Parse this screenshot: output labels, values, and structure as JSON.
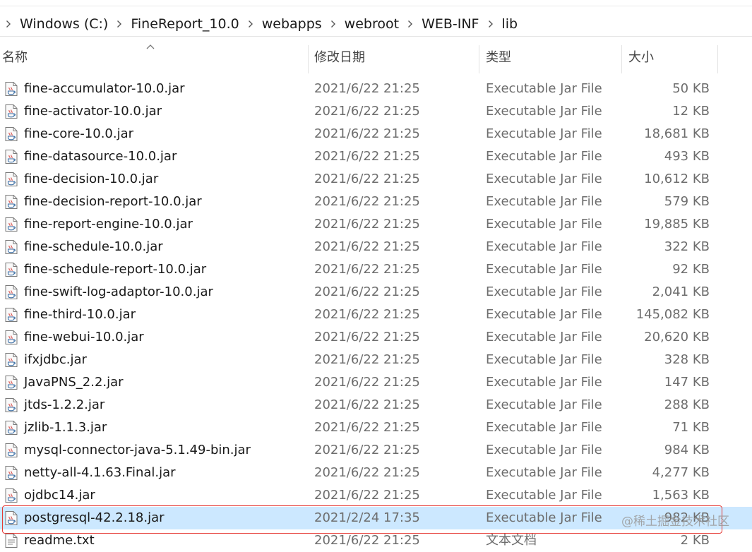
{
  "breadcrumb": [
    "Windows (C:)",
    "FineReport_10.0",
    "webapps",
    "webroot",
    "WEB-INF",
    "lib"
  ],
  "columns": {
    "name": "名称",
    "date": "修改日期",
    "type": "类型",
    "size": "大小"
  },
  "files": [
    {
      "name": "fine-accumulator-10.0.jar",
      "date": "2021/6/22 21:25",
      "type": "Executable Jar File",
      "size": "50 KB",
      "icon": "jar-file-icon"
    },
    {
      "name": "fine-activator-10.0.jar",
      "date": "2021/6/22 21:25",
      "type": "Executable Jar File",
      "size": "12 KB",
      "icon": "jar-file-icon"
    },
    {
      "name": "fine-core-10.0.jar",
      "date": "2021/6/22 21:25",
      "type": "Executable Jar File",
      "size": "18,681 KB",
      "icon": "jar-file-icon"
    },
    {
      "name": "fine-datasource-10.0.jar",
      "date": "2021/6/22 21:25",
      "type": "Executable Jar File",
      "size": "493 KB",
      "icon": "jar-file-icon"
    },
    {
      "name": "fine-decision-10.0.jar",
      "date": "2021/6/22 21:25",
      "type": "Executable Jar File",
      "size": "10,612 KB",
      "icon": "jar-file-icon"
    },
    {
      "name": "fine-decision-report-10.0.jar",
      "date": "2021/6/22 21:25",
      "type": "Executable Jar File",
      "size": "579 KB",
      "icon": "jar-file-icon"
    },
    {
      "name": "fine-report-engine-10.0.jar",
      "date": "2021/6/22 21:25",
      "type": "Executable Jar File",
      "size": "19,885 KB",
      "icon": "jar-file-icon"
    },
    {
      "name": "fine-schedule-10.0.jar",
      "date": "2021/6/22 21:25",
      "type": "Executable Jar File",
      "size": "322 KB",
      "icon": "jar-file-icon"
    },
    {
      "name": "fine-schedule-report-10.0.jar",
      "date": "2021/6/22 21:25",
      "type": "Executable Jar File",
      "size": "92 KB",
      "icon": "jar-file-icon"
    },
    {
      "name": "fine-swift-log-adaptor-10.0.jar",
      "date": "2021/6/22 21:25",
      "type": "Executable Jar File",
      "size": "2,041 KB",
      "icon": "jar-file-icon"
    },
    {
      "name": "fine-third-10.0.jar",
      "date": "2021/6/22 21:25",
      "type": "Executable Jar File",
      "size": "145,082 KB",
      "icon": "jar-file-icon"
    },
    {
      "name": "fine-webui-10.0.jar",
      "date": "2021/6/22 21:25",
      "type": "Executable Jar File",
      "size": "20,620 KB",
      "icon": "jar-file-icon"
    },
    {
      "name": "ifxjdbc.jar",
      "date": "2021/6/22 21:25",
      "type": "Executable Jar File",
      "size": "328 KB",
      "icon": "jar-file-icon"
    },
    {
      "name": "JavaPNS_2.2.jar",
      "date": "2021/6/22 21:25",
      "type": "Executable Jar File",
      "size": "147 KB",
      "icon": "jar-file-icon"
    },
    {
      "name": "jtds-1.2.2.jar",
      "date": "2021/6/22 21:25",
      "type": "Executable Jar File",
      "size": "288 KB",
      "icon": "jar-file-icon"
    },
    {
      "name": "jzlib-1.1.3.jar",
      "date": "2021/6/22 21:25",
      "type": "Executable Jar File",
      "size": "71 KB",
      "icon": "jar-file-icon"
    },
    {
      "name": "mysql-connector-java-5.1.49-bin.jar",
      "date": "2021/6/22 21:25",
      "type": "Executable Jar File",
      "size": "984 KB",
      "icon": "jar-file-icon"
    },
    {
      "name": "netty-all-4.1.63.Final.jar",
      "date": "2021/6/22 21:25",
      "type": "Executable Jar File",
      "size": "4,277 KB",
      "icon": "jar-file-icon"
    },
    {
      "name": "ojdbc14.jar",
      "date": "2021/6/22 21:25",
      "type": "Executable Jar File",
      "size": "1,563 KB",
      "icon": "jar-file-icon"
    },
    {
      "name": "postgresql-42.2.18.jar",
      "date": "2021/2/24 17:35",
      "type": "Executable Jar File",
      "size": "982 KB",
      "icon": "jar-file-icon",
      "selected": true
    },
    {
      "name": "readme.txt",
      "date": "2021/6/22 21:25",
      "type": "文本文档",
      "size": "2 KB",
      "icon": "text-file-icon"
    }
  ],
  "watermark": "@稀土掘金技术社区",
  "colors": {
    "selection": "#cce8ff",
    "highlight_border": "#e53935"
  }
}
